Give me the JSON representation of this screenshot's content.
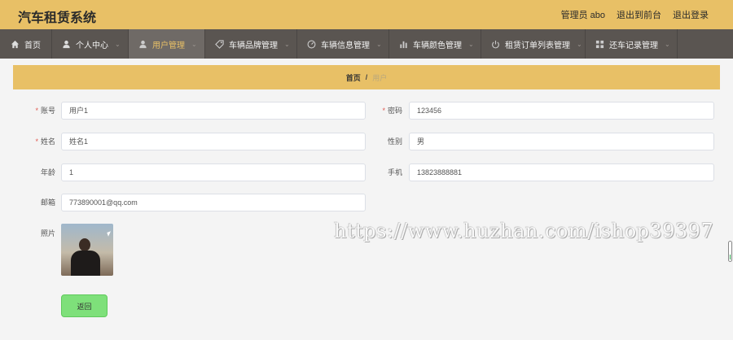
{
  "header": {
    "title": "汽车租赁系统",
    "admin": "管理员 abo",
    "to_front": "退出到前台",
    "logout": "退出登录"
  },
  "nav": [
    {
      "label": "首页",
      "icon": "home-icon",
      "dropdown": false,
      "active": false
    },
    {
      "label": "个人中心",
      "icon": "user-icon",
      "dropdown": true,
      "active": false
    },
    {
      "label": "用户管理",
      "icon": "user-icon",
      "dropdown": true,
      "active": true
    },
    {
      "label": "车辆品牌管理",
      "icon": "tag-icon",
      "dropdown": true,
      "active": false
    },
    {
      "label": "车辆信息管理",
      "icon": "gauge-icon",
      "dropdown": true,
      "active": false
    },
    {
      "label": "车辆颜色管理",
      "icon": "bar-chart-icon",
      "dropdown": true,
      "active": false
    },
    {
      "label": "租赁订单列表管理",
      "icon": "power-icon",
      "dropdown": true,
      "active": false
    },
    {
      "label": "还车记录管理",
      "icon": "grid-icon",
      "dropdown": true,
      "active": false
    }
  ],
  "breadcrumb": {
    "home": "首页",
    "sep": "/",
    "current": "用户"
  },
  "form": {
    "account": {
      "label": "账号",
      "value": "用户1",
      "required": true
    },
    "password": {
      "label": "密码",
      "value": "123456",
      "required": true
    },
    "name": {
      "label": "姓名",
      "value": "姓名1",
      "required": true
    },
    "gender": {
      "label": "性别",
      "value": "男",
      "required": false
    },
    "age": {
      "label": "年龄",
      "value": "1",
      "required": false
    },
    "phone": {
      "label": "手机",
      "value": "13823888881",
      "required": false
    },
    "email": {
      "label": "邮箱",
      "value": "773890001@qq.com",
      "required": false
    },
    "photo": {
      "label": "照片"
    },
    "back_label": "返回"
  },
  "watermark": "https://www.huzhan.com/ishop39397",
  "colors": {
    "accent": "#e8c066",
    "nav_bg": "#5a5551",
    "back_button": "#7ee07a"
  }
}
